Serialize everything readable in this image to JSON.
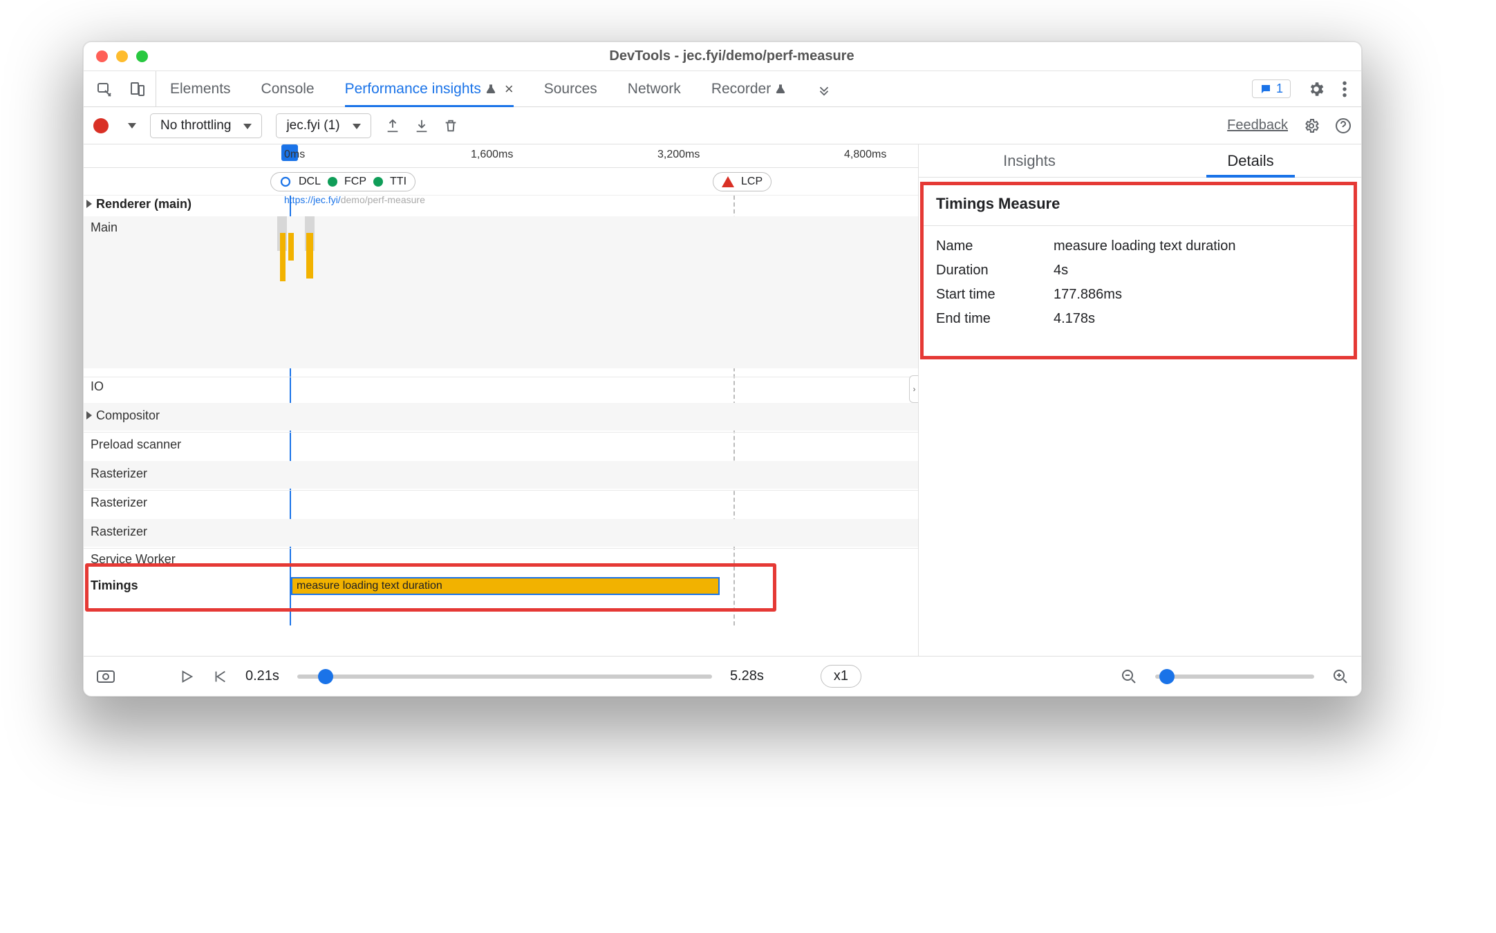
{
  "window": {
    "title": "DevTools - jec.fyi/demo/perf-measure"
  },
  "tabs": {
    "items": [
      "Elements",
      "Console",
      "Performance insights",
      "Sources",
      "Network",
      "Recorder"
    ],
    "active": "Performance insights",
    "messages_count": "1",
    "close_label": "×"
  },
  "toolbar": {
    "throttling": "No throttling",
    "recording": "jec.fyi (1)",
    "feedback": "Feedback"
  },
  "ruler": {
    "t0": "0ms",
    "t1": "1,600ms",
    "t2": "3,200ms",
    "t3": "4,800ms"
  },
  "markers": {
    "dcl": "DCL",
    "fcp": "FCP",
    "tti": "TTI",
    "lcp": "LCP"
  },
  "tracks": {
    "renderer": "Renderer (main)",
    "main": "Main",
    "io": "IO",
    "compositor": "Compositor",
    "preload": "Preload scanner",
    "rasterizer": "Rasterizer",
    "service_worker": "Service Worker",
    "timings": "Timings",
    "url_pre": "https://jec.fyi/",
    "url_rest": "demo/perf-measure",
    "measure_label": "measure loading text duration"
  },
  "right": {
    "tab_insights": "Insights",
    "tab_details": "Details",
    "heading": "Timings Measure",
    "rows": {
      "name_k": "Name",
      "name_v": "measure loading text duration",
      "dur_k": "Duration",
      "dur_v": "4s",
      "start_k": "Start time",
      "start_v": "177.886ms",
      "end_k": "End time",
      "end_v": "4.178s"
    }
  },
  "footer": {
    "start": "0.21s",
    "end": "5.28s",
    "speed": "x1"
  }
}
